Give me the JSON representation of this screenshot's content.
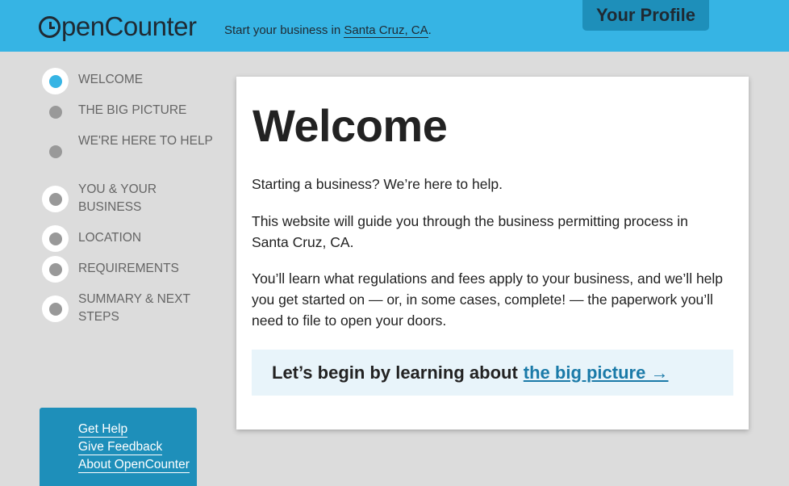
{
  "header": {
    "logo": "OpenCounter",
    "logo_o": "O",
    "logo_rest": "penCounter",
    "tagline_prefix": "Start your business in ",
    "tagline_location": "Santa Cruz, CA",
    "tagline_suffix": ".",
    "profile_button": "Your Profile"
  },
  "sidebar": {
    "steps": [
      {
        "label": "Welcome",
        "state": "active"
      },
      {
        "label": "The Big Picture",
        "state": "plain"
      },
      {
        "label": "We're here to help",
        "state": "plain"
      },
      {
        "label": "You & your business",
        "state": "circle"
      },
      {
        "label": "Location",
        "state": "circle"
      },
      {
        "label": "Requirements",
        "state": "circle"
      },
      {
        "label": "Summary & next steps",
        "state": "circle"
      }
    ],
    "help_links": [
      "Get Help",
      "Give Feedback",
      "About OpenCounter"
    ]
  },
  "main": {
    "title": "Welcome",
    "paragraphs": [
      "Starting a business? We’re here to help.",
      "This website will guide you through the business permitting process in Santa Cruz, CA.",
      "You’ll learn what regulations and fees apply to your business, and we’ll help you get started on — or, in some cases, complete! — the paperwork you’ll need to file to open your doors."
    ],
    "cta_text": "Let’s begin by learning about",
    "cta_link": "the big picture →"
  },
  "colors": {
    "header_bg": "#36b4e4",
    "accent_dark": "#1e8fba",
    "page_bg": "#dcdcdc",
    "cta_bg": "#e8f4fa",
    "link": "#1a7aa8"
  }
}
